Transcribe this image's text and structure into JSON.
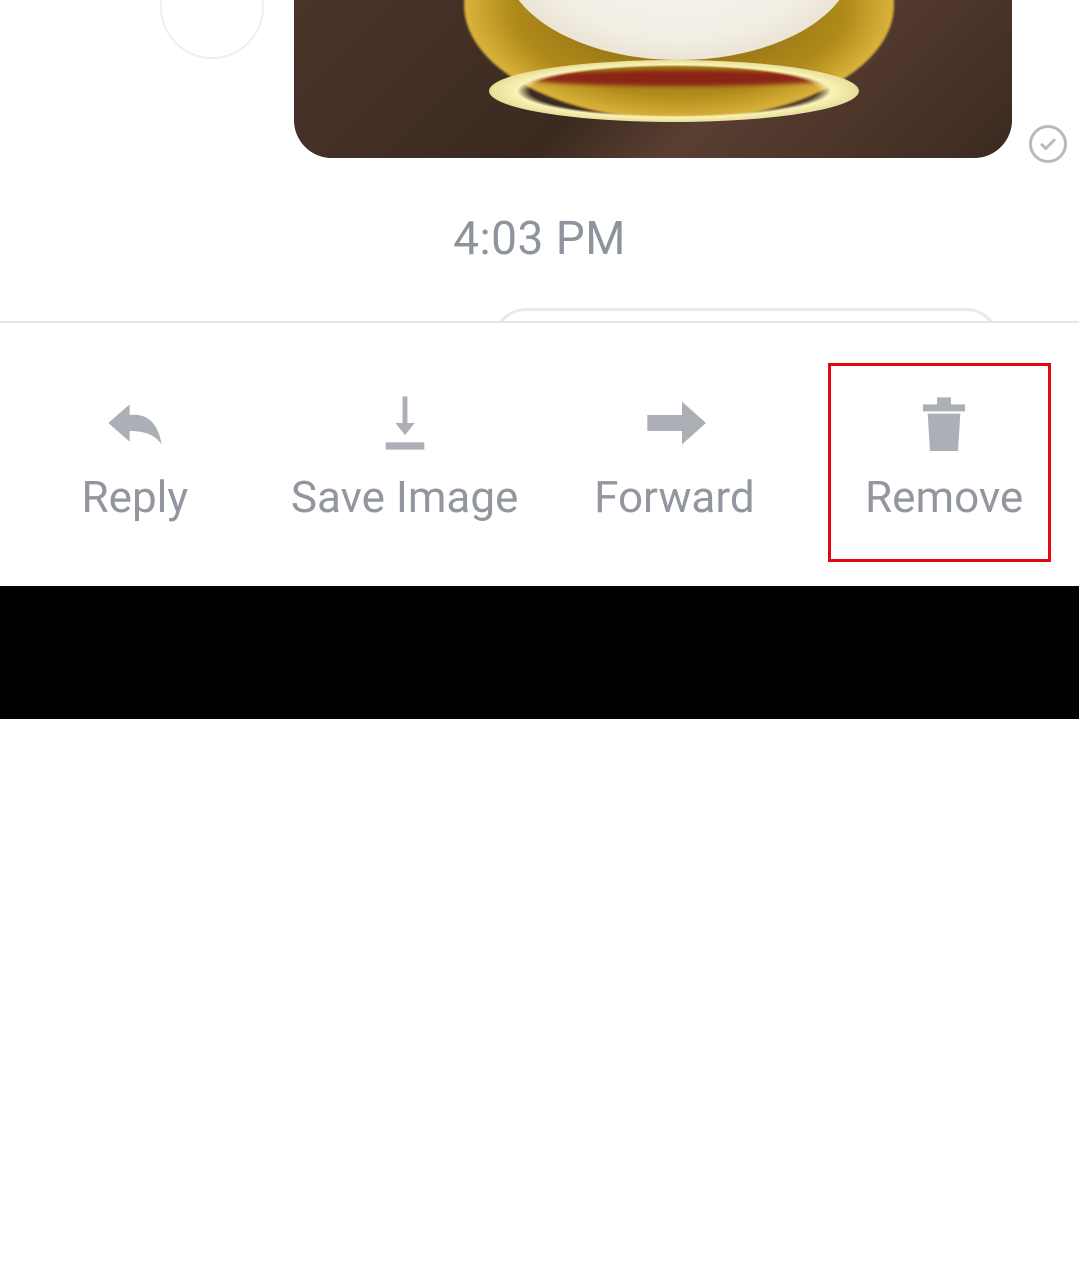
{
  "message": {
    "timestamp": "4:03 PM",
    "delivery_status_icon": "checkmark-circle"
  },
  "actions": {
    "reply": {
      "label": "Reply"
    },
    "save": {
      "label": "Save Image"
    },
    "forward": {
      "label": "Forward"
    },
    "remove": {
      "label": "Remove"
    }
  },
  "highlight": {
    "target_action": "remove",
    "color": "#e30613"
  }
}
